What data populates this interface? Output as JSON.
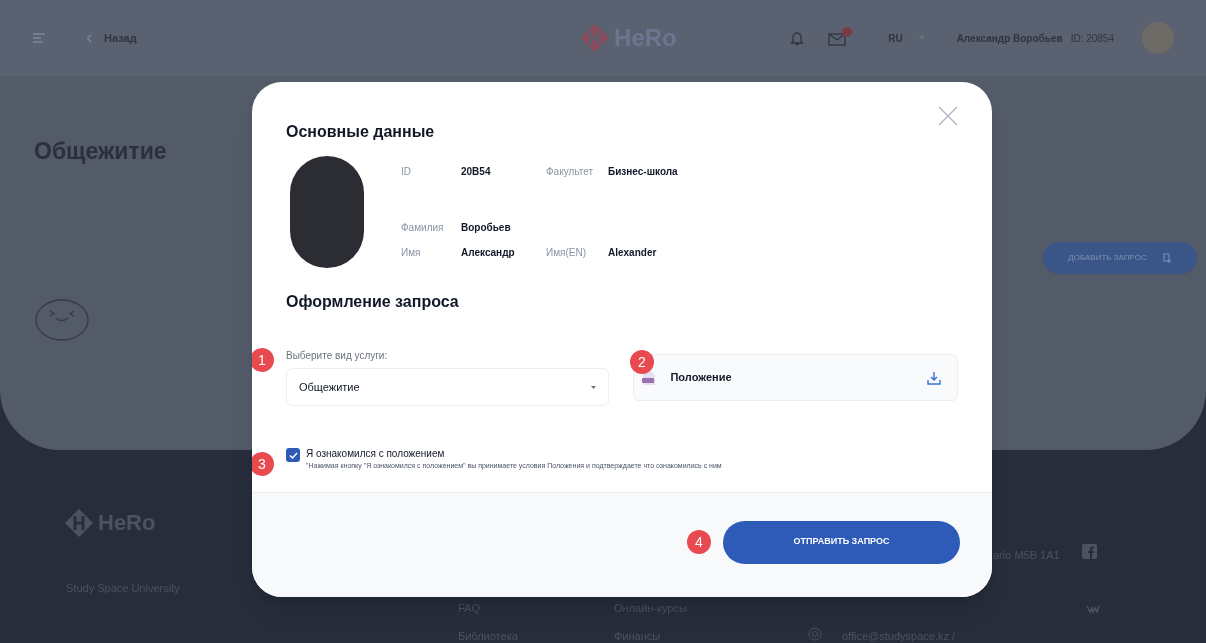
{
  "header": {
    "back": "Назад",
    "logo": "HeRo",
    "has_unread_mail": true,
    "language": "RU",
    "user_name": "Александр Воробьев",
    "user_id": "ID: 20854"
  },
  "page": {
    "title": "Общежитие",
    "add_button": "ДОБАВИТЬ ЗАПРОС"
  },
  "footer": {
    "logo": "HeRo",
    "university": "Study Space University",
    "address": "ario M5B 1A1",
    "links": [
      {
        "text": "FAQ"
      },
      {
        "text": "Онлайн-курсы"
      },
      {
        "text": "Библиотека"
      },
      {
        "text": "Финансы"
      }
    ],
    "email": "office@studyspace.kz /"
  },
  "modal": {
    "title": "Основные данные",
    "info_rows": [
      [
        {
          "label": "ID",
          "value": "20B54"
        },
        {
          "label": "Факультет",
          "value": "Бизнес-школа"
        }
      ],
      [
        {
          "label": "Фамилия",
          "value": "Воробьев"
        }
      ],
      [
        {
          "label": "Имя",
          "value": "Александр"
        },
        {
          "label": "Имя(EN)",
          "value": "Alexander"
        }
      ]
    ],
    "request_title": "Оформление запроса",
    "service": {
      "label": "Выберите вид услуги:",
      "value": "Общежитие"
    },
    "document": {
      "name": "Положение"
    },
    "agreement": {
      "checked": true,
      "label": "Я ознакомился с положением",
      "note": "\"Нажимая кнопку \"Я ознакомился с положением\" вы принимаете условия Положения и подтверждаете что ознакомились с ним"
    },
    "submit": "ОТПРАВИТЬ ЗАПРОС",
    "markers": [
      "1",
      "2",
      "3",
      "4"
    ]
  }
}
